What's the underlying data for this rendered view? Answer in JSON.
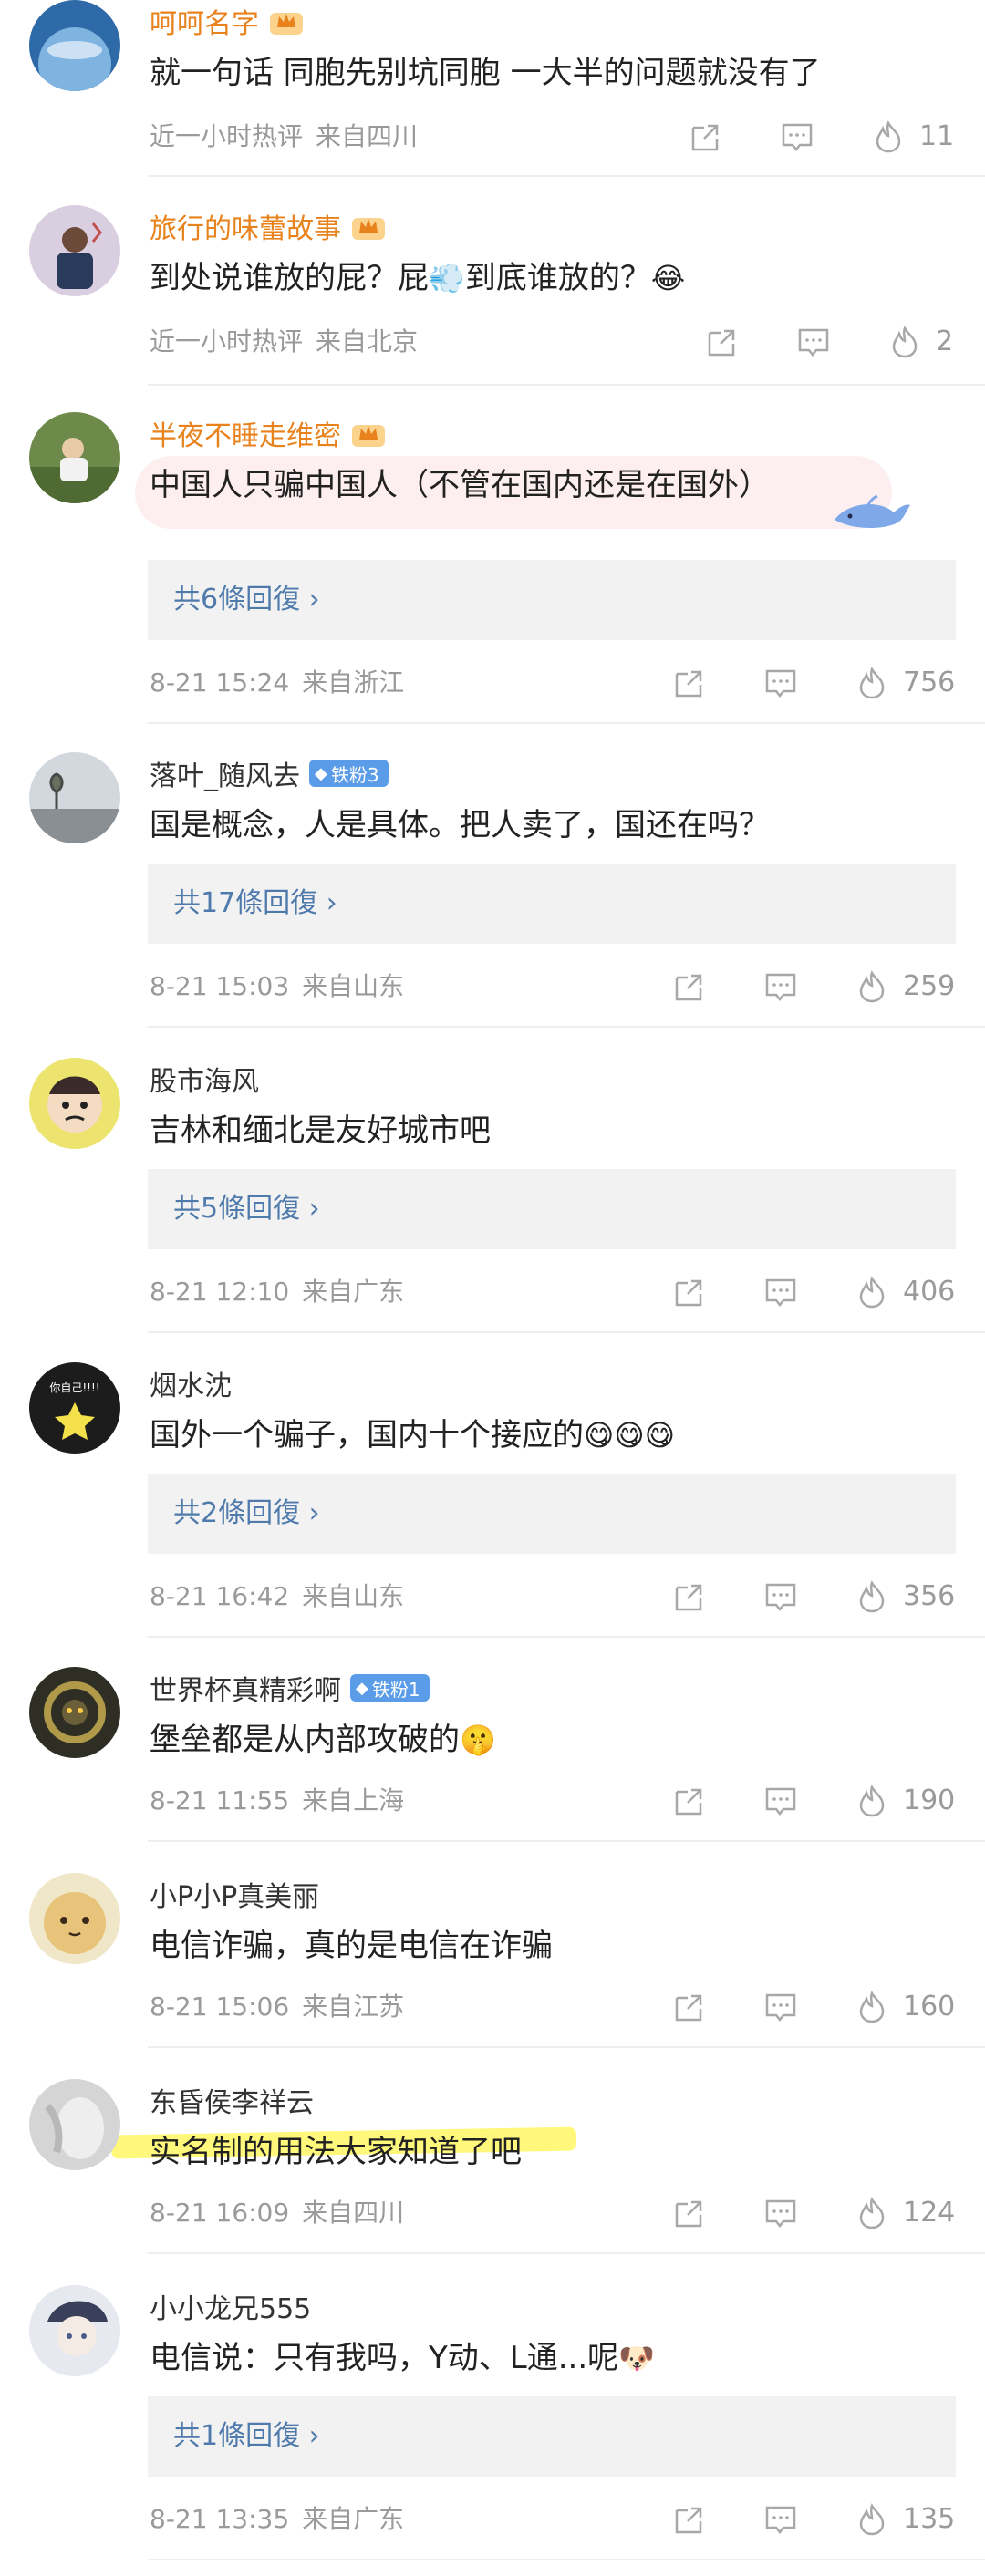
{
  "comments": [
    {
      "name": "呵呵名字",
      "vip": true,
      "fan_badge": "",
      "text": "就一句话 同胞先别坑同胞 一大半的问题就没有了",
      "time": "近一小时热评",
      "location": "来自四川",
      "likes": "11",
      "reply_label": "",
      "avatar_color": "#2e6aa8"
    },
    {
      "name": "旅行的味蕾故事",
      "vip": true,
      "fan_badge": "",
      "text": "到处说谁放的屁？屁",
      "text_tail": "到底谁放的？",
      "time": "近一小时热评",
      "location": "来自北京",
      "likes": "2",
      "reply_label": "",
      "avatar_color": "#c9b7c7"
    },
    {
      "name": "半夜不睡走维密",
      "vip": true,
      "fan_badge": "",
      "text": "中国人只骗中国人（不管在国内还是在国外）",
      "time": "8-21 15:24",
      "location": "来自浙江",
      "likes": "756",
      "reply_label": "共6條回復",
      "avatar_color": "#7c8a5a"
    },
    {
      "name": "落叶_随风去",
      "vip": false,
      "fan_badge": "铁粉3",
      "text": "国是概念，人是具体。把人卖了，国还在吗？",
      "time": "8-21 15:03",
      "location": "来自山东",
      "likes": "259",
      "reply_label": "共17條回復",
      "avatar_color": "#cfd4d8"
    },
    {
      "name": "股市海风",
      "vip": false,
      "fan_badge": "",
      "text": "吉林和缅北是友好城市吧",
      "time": "8-21 12:10",
      "location": "来自广东",
      "likes": "406",
      "reply_label": "共5條回復",
      "avatar_color": "#e9e06a"
    },
    {
      "name": "烟水沈",
      "vip": false,
      "fan_badge": "",
      "text": "国外一个骗子，国内十个接应的",
      "time": "8-21 16:42",
      "location": "来自山东",
      "likes": "356",
      "reply_label": "共2條回復",
      "avatar_color": "#1c1c1c",
      "avatar_text": "你自己!!!!"
    },
    {
      "name": "世界杯真精彩啊",
      "vip": false,
      "fan_badge": "铁粉1",
      "text": "堡垒都是从内部攻破的",
      "time": "8-21 11:55",
      "location": "来自上海",
      "likes": "190",
      "reply_label": "",
      "avatar_color": "#3b3a2e"
    },
    {
      "name": "小P小P真美丽",
      "vip": false,
      "fan_badge": "",
      "text": "电信诈骗，真的是电信在诈骗",
      "time": "8-21 15:06",
      "location": "来自江苏",
      "likes": "160",
      "reply_label": "",
      "avatar_color": "#e8c47a"
    },
    {
      "name": "东昏侯李祥云",
      "vip": false,
      "fan_badge": "",
      "text": "实名制的用法大家知道了吧",
      "time": "8-21 16:09",
      "location": "来自四川",
      "likes": "124",
      "reply_label": "",
      "avatar_color": "#cfcfcf"
    },
    {
      "name": "小小龙兄555",
      "vip": false,
      "fan_badge": "",
      "text": "电信说：只有我吗，Y动、L通...呢",
      "time": "8-21 13:35",
      "location": "来自广东",
      "likes": "135",
      "reply_label": "共1條回復",
      "avatar_color": "#dfe3ea"
    }
  ],
  "icons": {
    "share": "share-icon",
    "comment": "comment-icon",
    "like": "like-flame-icon"
  },
  "colors": {
    "vip_name": "#e8821c",
    "reply_link": "#4f7aac",
    "meta": "#9a9a9a",
    "fan_badge": "#5b9ce8"
  }
}
